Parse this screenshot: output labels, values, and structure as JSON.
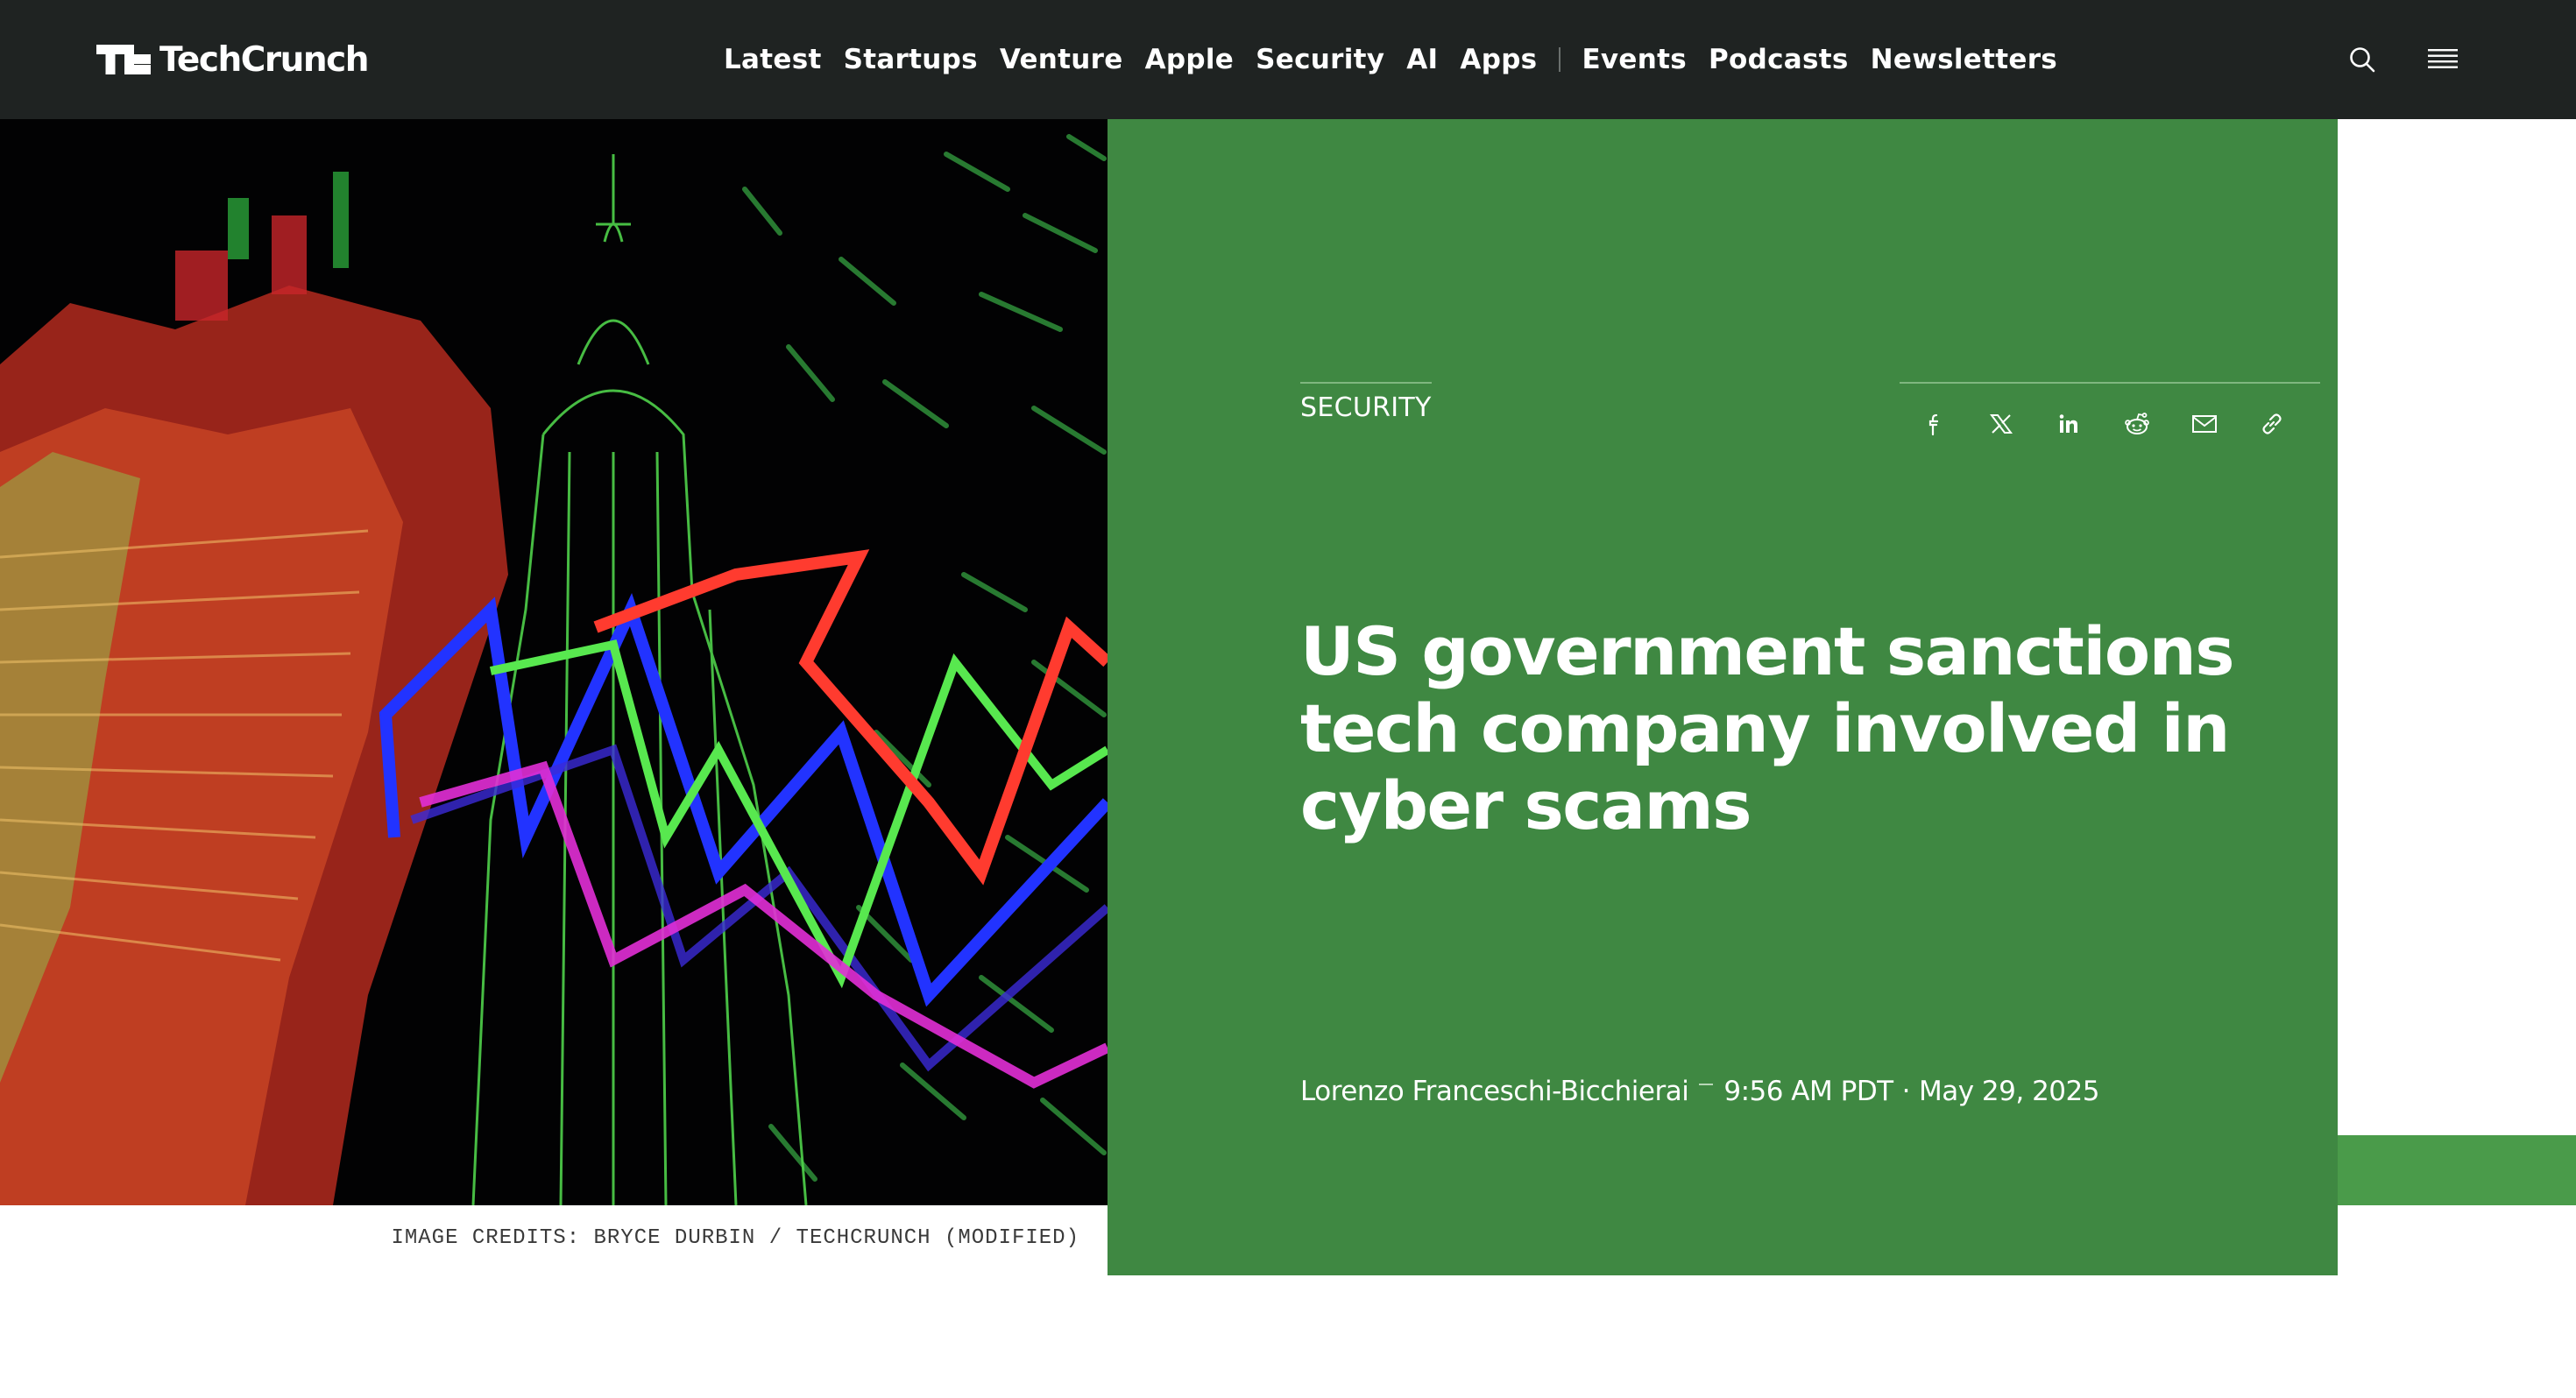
{
  "site": {
    "logo_text": "TechCrunch",
    "logo_icon": "tc-logo-mark"
  },
  "nav": {
    "primary": [
      "Latest",
      "Startups",
      "Venture",
      "Apple",
      "Security",
      "AI",
      "Apps"
    ],
    "secondary": [
      "Events",
      "Podcasts",
      "Newsletters"
    ],
    "search_icon": "search-icon",
    "menu_icon": "hamburger-menu-icon"
  },
  "article": {
    "category": "SECURITY",
    "title": "US government sanctions tech company involved in cyber scams",
    "author": "Lorenzo Franceschi-Bicchierai",
    "time": "9:56 AM PDT",
    "date": "May 29, 2025",
    "image_credit": "IMAGE CREDITS: BRYCE DURBIN / TECHCRUNCH (MODIFIED)"
  },
  "share_icons": [
    "facebook-icon",
    "x-icon",
    "linkedin-icon",
    "reddit-icon",
    "email-icon",
    "link-icon"
  ],
  "colors": {
    "nav_bg": "#1f2322",
    "hero_green": "#3f8842",
    "accent_green": "#4a9b4a",
    "text_white": "#ffffff"
  }
}
